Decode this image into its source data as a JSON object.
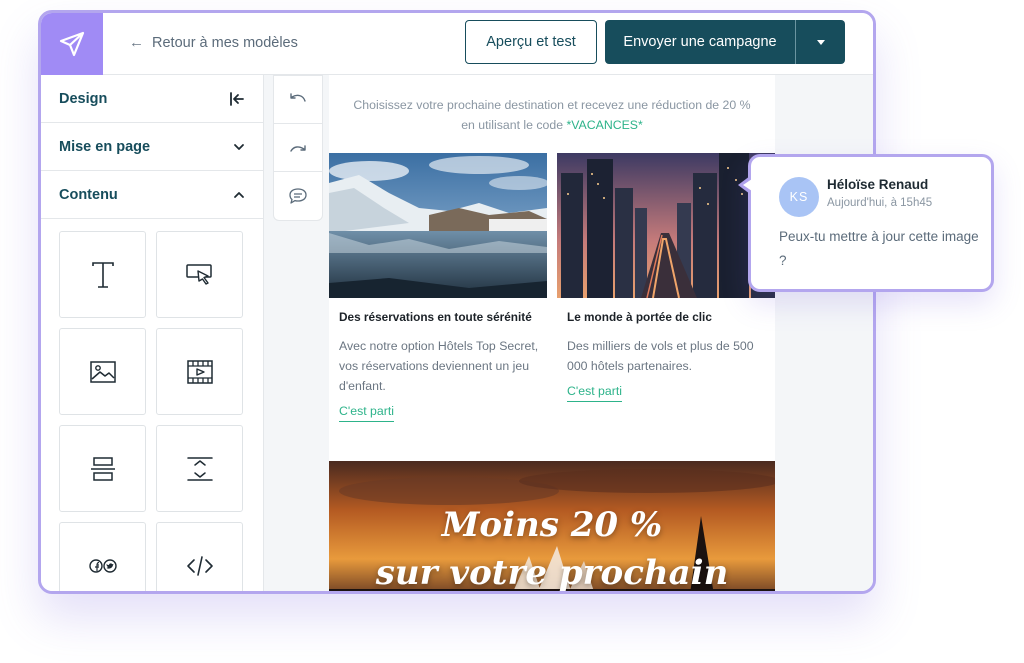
{
  "header": {
    "back_label": "Retour à mes modèles",
    "preview_label": "Aperçu et test",
    "send_label": "Envoyer une campagne"
  },
  "sidebar": {
    "sections": [
      {
        "label": "Design",
        "icon": "collapse-left-icon"
      },
      {
        "label": "Mise en page",
        "icon": "chevron-down-icon"
      },
      {
        "label": "Contenu",
        "icon": "chevron-up-icon"
      }
    ],
    "blocks": [
      {
        "icon": "text-block-icon"
      },
      {
        "icon": "button-block-icon"
      },
      {
        "icon": "image-block-icon"
      },
      {
        "icon": "video-block-icon"
      },
      {
        "icon": "divider-block-icon"
      },
      {
        "icon": "spacer-block-icon"
      },
      {
        "icon": "social-block-icon"
      },
      {
        "icon": "html-block-icon"
      }
    ]
  },
  "tools": [
    "undo-icon",
    "redo-icon",
    "comment-icon"
  ],
  "email": {
    "intro": "Choisissez votre prochaine destination et recevez une réduction de 20 % en utilisant le code",
    "promo_code": "*VACANCES*",
    "columns": [
      {
        "title": "Des réservations en toute sérénité",
        "text": "Avec notre option Hôtels Top Secret, vos réservations deviennent un jeu d'enfant.",
        "cta": "C'est parti"
      },
      {
        "title": "Le monde à portée de clic",
        "text": "Des milliers de vols et plus de 500 000 hôtels partenaires.",
        "cta": "C'est parti"
      }
    ],
    "banner": {
      "line1": "Moins 20 %",
      "line2": "sur votre prochain"
    }
  },
  "comment": {
    "initials": "KS",
    "author": "Héloïse Renaud",
    "time": "Aujourd'hui, à 15h45",
    "text": "Peux-tu mettre à jour cette image ?"
  },
  "colors": {
    "brand_purple": "#a08bf5",
    "primary_teal": "#174d5c",
    "link_green": "#2db38a",
    "avatar_blue": "#a9c4f5"
  }
}
